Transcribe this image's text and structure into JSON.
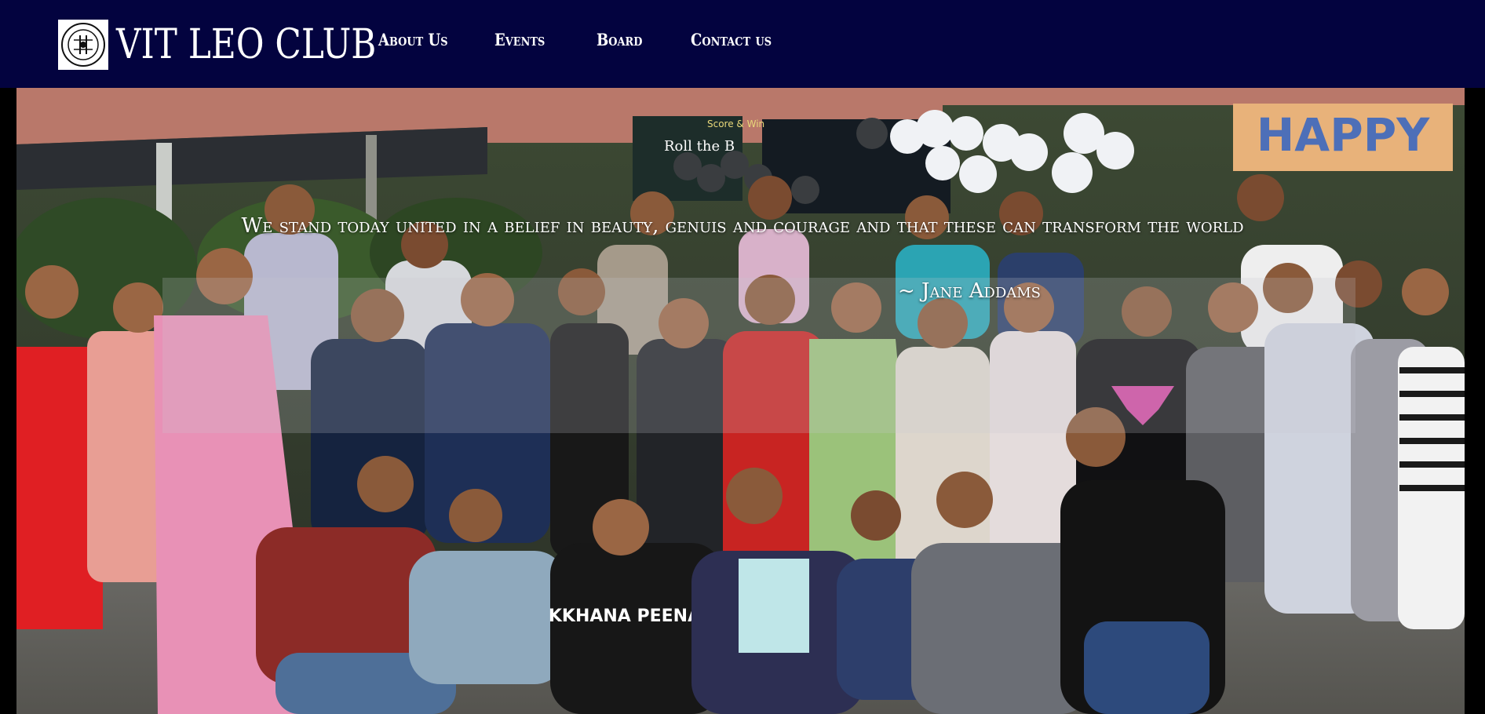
{
  "brand": {
    "name": "VIT LEO CLUB",
    "logo_icon": "leo-club-emblem-icon",
    "logo_caption_top": "LEO CLUB",
    "logo_caption_bottom": "VIT LEOS"
  },
  "nav": {
    "items": [
      {
        "label": "About Us"
      },
      {
        "label": "Events"
      },
      {
        "label": "Board"
      },
      {
        "label": "Contact us"
      }
    ]
  },
  "hero": {
    "photo": "group-photo-of-club-members",
    "banner_text": "HAPPY",
    "sign_text_1": "Roll the B",
    "sign_text_2": "Score & Win",
    "shirt_text": "KKHANA PEENA",
    "quote": {
      "text": "We stand today united in a belief in beauty, genuis and courage and that these can transform the world",
      "author": "~ Jane Addams"
    }
  },
  "colors": {
    "navbar": "#03033f",
    "nav_text": "#ffffff",
    "page_background": "#000000"
  }
}
